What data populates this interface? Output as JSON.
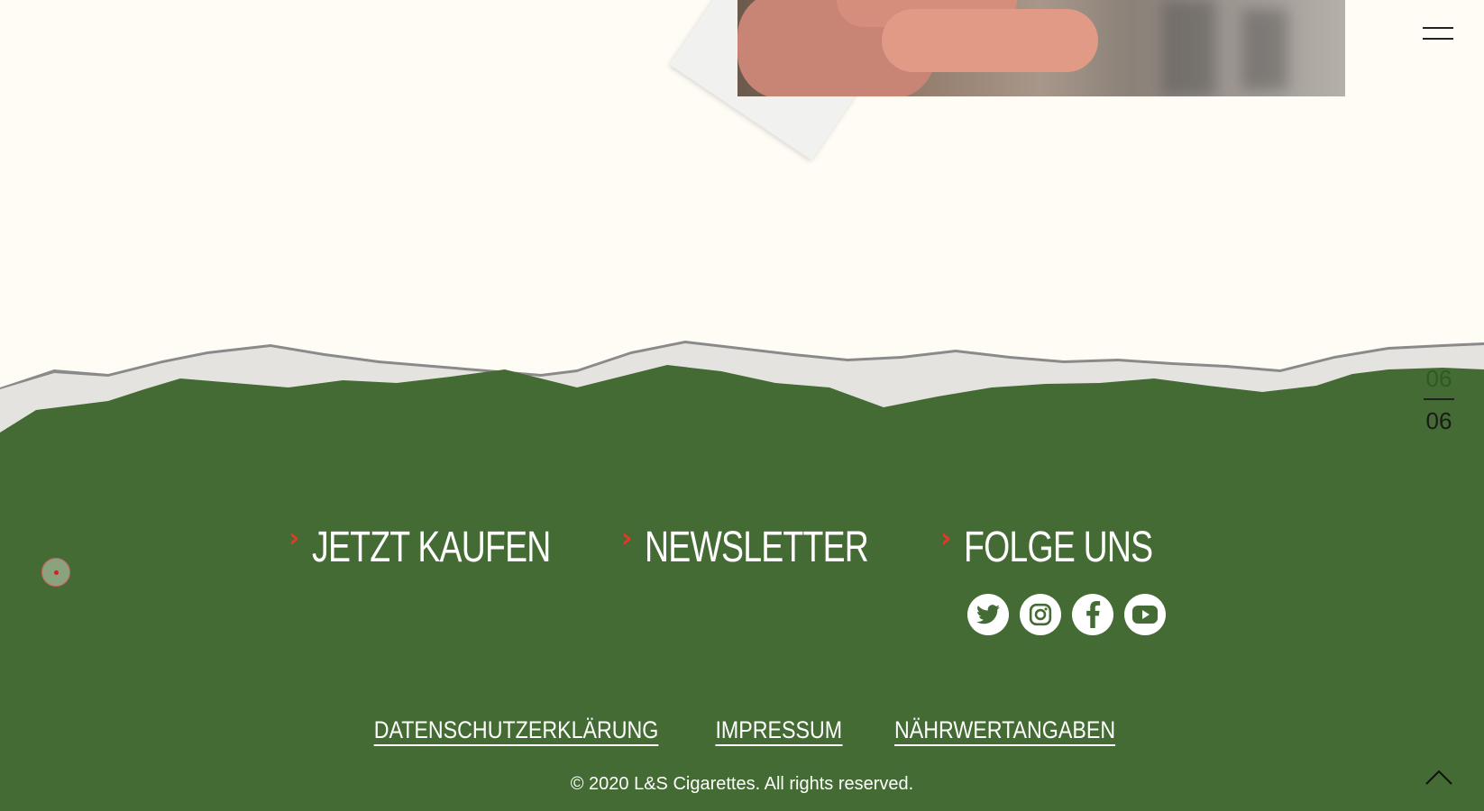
{
  "nav": {
    "menu_icon": "hamburger-icon"
  },
  "pager": {
    "current": "06",
    "total": "06"
  },
  "cta": [
    {
      "label": "JETZT KAUFEN",
      "icon": "chevron-right-icon"
    },
    {
      "label": "NEWSLETTER",
      "icon": "chevron-right-icon"
    },
    {
      "label": "FOLGE UNS",
      "icon": "chevron-right-icon"
    }
  ],
  "social": [
    "twitter-icon",
    "instagram-icon",
    "facebook-icon",
    "youtube-icon"
  ],
  "footer_links": [
    "DATENSCHUTZERKLÄRUNG",
    "IMPRESSUM",
    "NÄHRWERTANGABEN"
  ],
  "copyright": "© 2020 L&S Cigarettes. All rights reserved.",
  "colors": {
    "background": "#fffcf5",
    "footer_green": "#436b33",
    "accent_red": "#e23a2a",
    "text_light": "#ffffff"
  }
}
